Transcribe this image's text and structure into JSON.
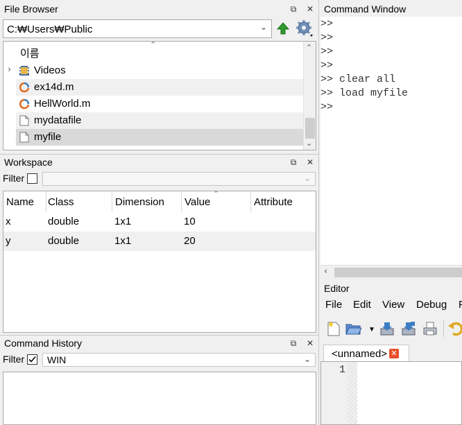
{
  "file_browser": {
    "title": "File Browser",
    "path": "C:₩Users₩Public",
    "column_header": "이름",
    "items": [
      {
        "name": "Videos",
        "icon": "video-folder-icon",
        "expandable": true
      },
      {
        "name": "ex14d.m",
        "icon": "matlab-script-icon"
      },
      {
        "name": "HellWorld.m",
        "icon": "matlab-script-icon"
      },
      {
        "name": "mydatafile",
        "icon": "file-icon"
      },
      {
        "name": "myfile",
        "icon": "file-icon",
        "selected": true
      }
    ]
  },
  "workspace": {
    "title": "Workspace",
    "filter_label": "Filter",
    "filter_checked": false,
    "columns": [
      "Name",
      "Class",
      "Dimension",
      "Value",
      "Attribute"
    ],
    "rows": [
      {
        "name": "x",
        "class": "double",
        "dimension": "1x1",
        "value": "10",
        "attribute": ""
      },
      {
        "name": "y",
        "class": "double",
        "dimension": "1x1",
        "value": "20",
        "attribute": ""
      }
    ]
  },
  "command_history": {
    "title": "Command History",
    "filter_label": "Filter",
    "filter_checked": true,
    "filter_value": "WIN"
  },
  "command_window": {
    "title": "Command Window",
    "lines": [
      ">>",
      ">>",
      ">>",
      ">>",
      ">> clear all",
      ">> load myfile",
      ">>"
    ]
  },
  "editor": {
    "title": "Editor",
    "menu": [
      "File",
      "Edit",
      "View",
      "Debug",
      "F"
    ],
    "tab_label": "<unnamed>",
    "line_number": "1"
  },
  "colors": {
    "selected_row": "#d9d9d9",
    "alt_row": "#f0f0f0",
    "green_arrow": "#2e9b2e",
    "close_red": "#e8502b"
  }
}
